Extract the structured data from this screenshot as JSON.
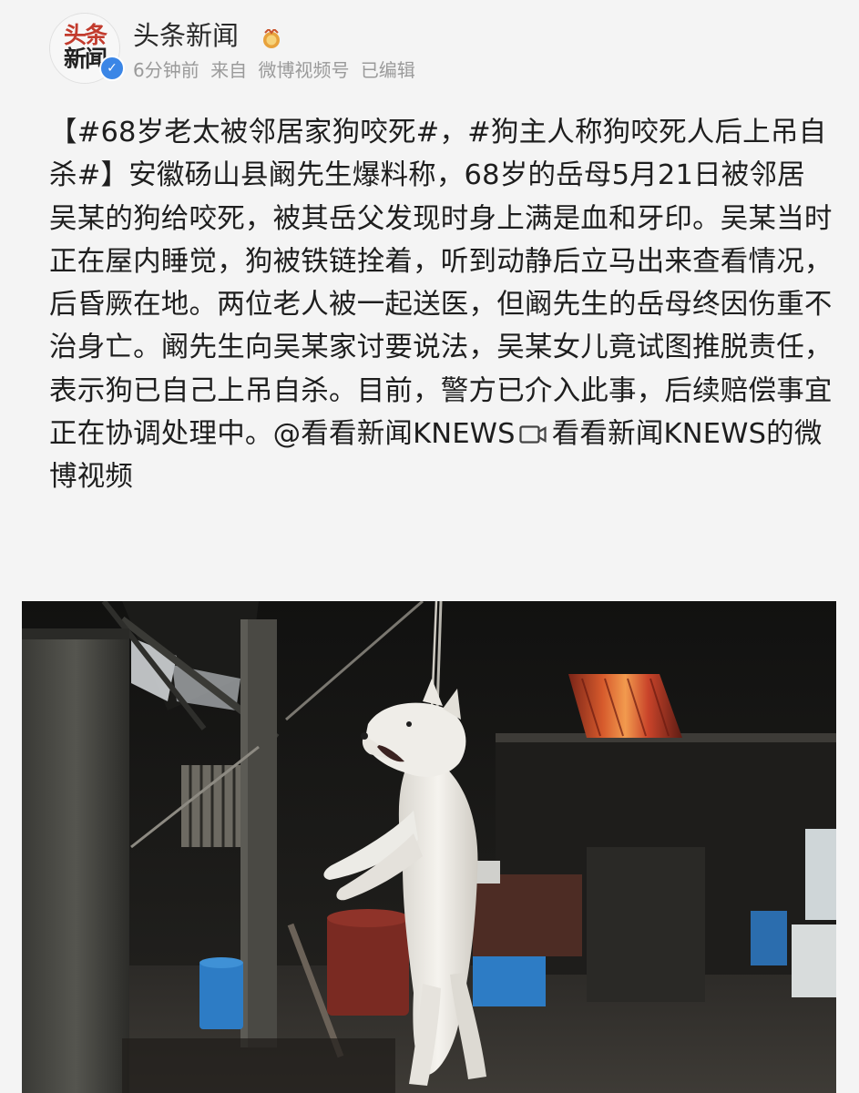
{
  "account": {
    "name": "头条新闻",
    "avatar_line1": "头条",
    "avatar_line2": "新闻",
    "time": "6分钟前",
    "source_prefix": "来自",
    "source": "微博视频号",
    "edited": "已编辑"
  },
  "post": {
    "text": "【#68岁老太被邻居家狗咬死#，#狗主人称狗咬死人后上吊自杀#】安徽砀山县阚先生爆料称，68岁的岳母5月21日被邻居吴某的狗给咬死，被其岳父发现时身上满是血和牙印。吴某当时正在屋内睡觉，狗被铁链拴着，听到动静后立马出来查看情况，后昏厥在地。两位老人被一起送医，但阚先生的岳母终因伤重不治身亡。阚先生向吴某家讨要说法，吴某女儿竟试图推脱责任，表示狗已自己上吊自杀。目前，警方已介入此事，后续赔偿事宜正在协调处理中。@看看新闻KNEWS",
    "video_link": "看看新闻KNEWS的微博视频"
  },
  "icons": {
    "verified": "verified-badge-icon",
    "medal": "medal-icon",
    "video": "video-camera-icon"
  },
  "colors": {
    "background": "#f4f4f4",
    "text": "#1e1e1e",
    "meta": "#9a9a9a",
    "verified_blue": "#3b86e6",
    "brand_red": "#c23b2d"
  }
}
